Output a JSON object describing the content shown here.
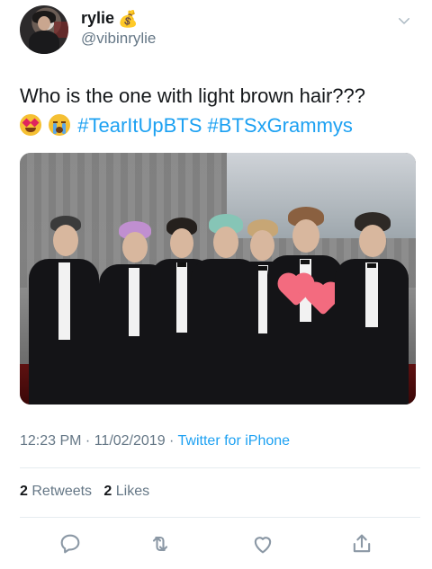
{
  "user": {
    "display_name": "rylie",
    "handle": "@vibinrylie",
    "money_icon": "💰"
  },
  "tweet": {
    "line1": "Who is the one with light brown hair???",
    "hashtags": [
      "#TearItUpBTS",
      "#BTSxGrammys"
    ]
  },
  "meta": {
    "time_date": "12:23 PM · 11/02/2019 · ",
    "source": "Twitter for iPhone"
  },
  "stats": {
    "retweets_count": "2",
    "retweets_label": "Retweets",
    "likes_count": "2",
    "likes_label": "Likes"
  },
  "actions": [
    "reply-icon",
    "retweet-icon",
    "like-icon",
    "share-icon"
  ],
  "colors": {
    "link": "#1da1f2",
    "secondary": "#657786",
    "heart_sticker": "#f36b7f"
  }
}
